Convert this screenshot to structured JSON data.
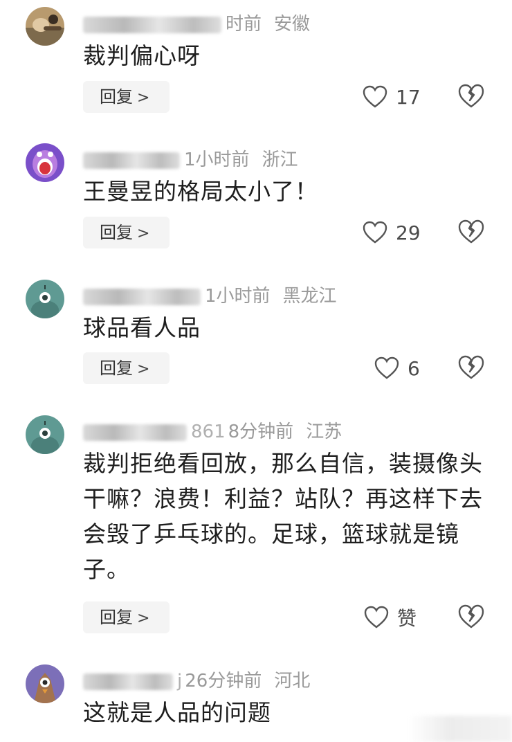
{
  "comments": [
    {
      "username_visible": "",
      "time": "时前",
      "region": "安徽",
      "text": "裁判偏心呀",
      "reply_label": "回复",
      "likes": "17"
    },
    {
      "username_visible": "",
      "time": "1小时前",
      "region": "浙江",
      "text": "王曼昱的格局太小了！",
      "reply_label": "回复",
      "likes": "29"
    },
    {
      "username_visible": "",
      "time": "1小时前",
      "region": "黑龙江",
      "text": "球品看人品",
      "reply_label": "回复",
      "likes": "6"
    },
    {
      "username_visible": "861",
      "time": "8分钟前",
      "region": "江苏",
      "text": "裁判拒绝看回放，那么自信，装摄像头干嘛？浪费！利益？站队？再这样下去会毁了乒乓球的。足球，篮球就是镜子。",
      "reply_label": "回复",
      "likes": "赞"
    },
    {
      "username_visible": "j",
      "time": "26分钟前",
      "region": "河北",
      "text": "这就是人品的问题"
    }
  ],
  "icons": {
    "like": "heart-outline-icon",
    "dislike": "broken-heart-icon",
    "reply_chevron": "chevron-right-icon"
  },
  "colors": {
    "text": "#1e1e1e",
    "meta": "#9a9a9a",
    "reply_bg": "#f4f4f4",
    "avatar_teal": "#5f9a93"
  }
}
